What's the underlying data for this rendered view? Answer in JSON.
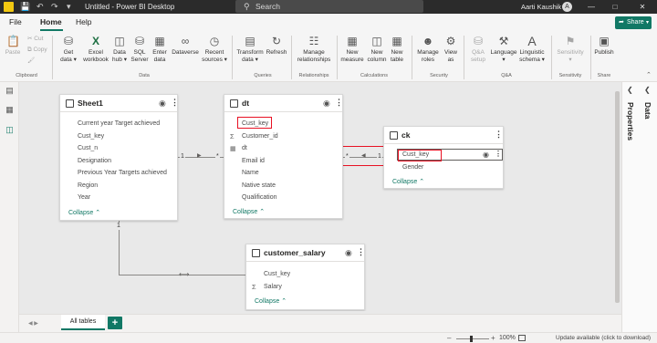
{
  "titlebar": {
    "title": "Untitled - Power BI Desktop",
    "search_placeholder": "Search",
    "user_name": "Aarti Kaushik",
    "avatar_initial": "A"
  },
  "menu": {
    "tabs": [
      "File",
      "Home",
      "Help"
    ],
    "share_label": "Share"
  },
  "ribbon": {
    "clipboard": {
      "paste": "Paste",
      "cut": "Cut",
      "copy": "Copy",
      "group": "Clipboard"
    },
    "data": {
      "get_data": [
        "Get",
        "data"
      ],
      "excel": [
        "Excel",
        "workbook"
      ],
      "hub": [
        "Data",
        "hub"
      ],
      "sql": [
        "SQL",
        "Server"
      ],
      "enter": [
        "Enter",
        "data"
      ],
      "dataverse": "Dataverse",
      "recent": [
        "Recent",
        "sources"
      ],
      "group": "Data"
    },
    "queries": {
      "transform": [
        "Transform",
        "data"
      ],
      "refresh": "Refresh",
      "group": "Queries"
    },
    "relationships": {
      "manage": [
        "Manage",
        "relationships"
      ],
      "group": "Relationships"
    },
    "calculations": {
      "measure": [
        "New",
        "measure"
      ],
      "column": [
        "New",
        "column"
      ],
      "table": [
        "New",
        "table"
      ],
      "group": "Calculations"
    },
    "security": {
      "roles": [
        "Manage",
        "roles"
      ],
      "view_as": [
        "View",
        "as"
      ],
      "group": "Security"
    },
    "qa": {
      "setup": [
        "Q&A",
        "setup"
      ],
      "language": "Language",
      "schema": [
        "Linguistic",
        "schema"
      ],
      "group": "Q&A"
    },
    "sensitivity": {
      "label": "Sensitivity",
      "group": "Sensitivity"
    },
    "share": {
      "publish": "Publish",
      "group": "Share"
    }
  },
  "right_panels": {
    "data": "Data",
    "properties": "Properties"
  },
  "tables": {
    "sheet1": {
      "name": "Sheet1",
      "fields": [
        "Current year Target achieved",
        "Cust_key",
        "Cust_n",
        "Designation",
        "Previous Year Targets achieved",
        "Region",
        "Year"
      ],
      "collapse": "Collapse"
    },
    "dt": {
      "name": "dt",
      "fields": [
        "Cust_key",
        "Customer_id",
        "dt",
        "Email id",
        "Name",
        "Native state",
        "Qualification"
      ],
      "collapse": "Collapse"
    },
    "ck": {
      "name": "ck",
      "fields": [
        "Cust_key",
        "Gender"
      ],
      "collapse": "Collapse"
    },
    "customer_salary": {
      "name": "customer_salary",
      "fields": [
        "Cust_key",
        "Salary"
      ],
      "collapse": "Collapse"
    }
  },
  "relationships": {
    "sheet1_dt": {
      "from": "1",
      "to": "*"
    },
    "dt_ck": {
      "from": "*",
      "to": "1"
    },
    "sheet1_salary": {
      "from": "1"
    }
  },
  "tabs": {
    "all_tables": "All tables",
    "add": "+"
  },
  "status": {
    "zoom": "100%",
    "update": "Update available (click to download)"
  }
}
